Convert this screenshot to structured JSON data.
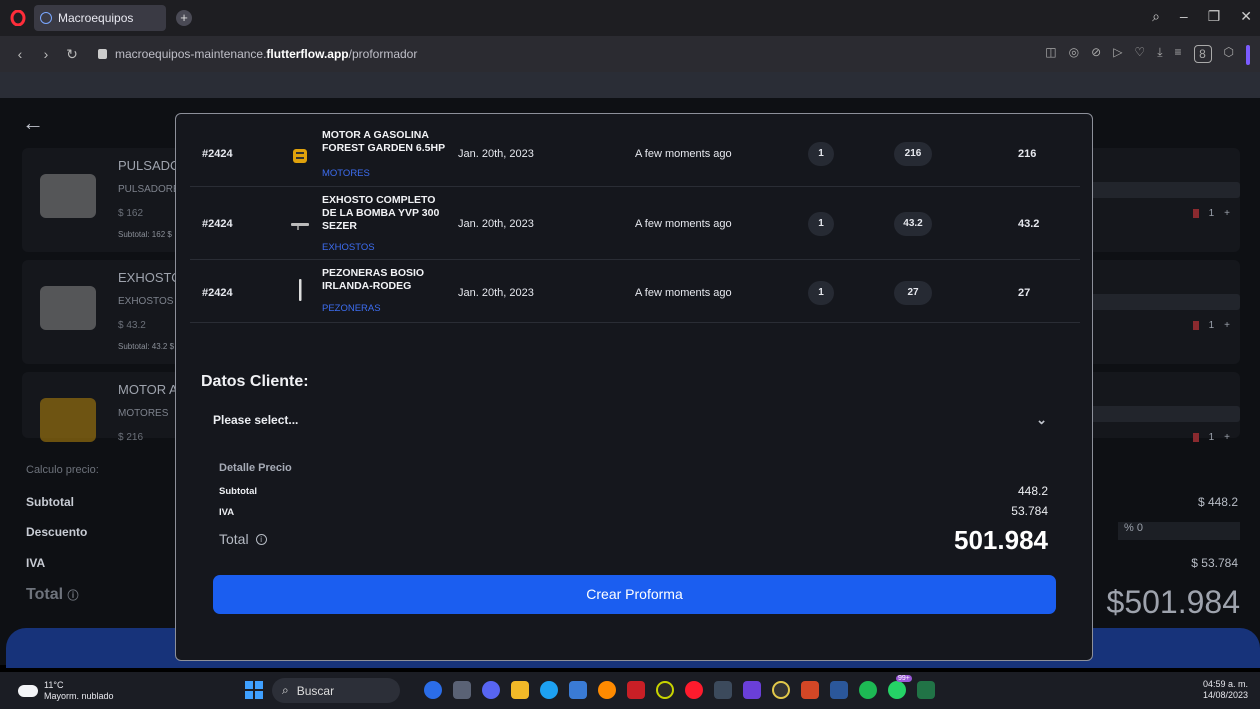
{
  "browser": {
    "tab_title": "Macroequipos",
    "url_prefix": "macroequipos-maintenance.",
    "url_domain": "flutterflow.app",
    "url_path": "/proformador",
    "account_badge": "8"
  },
  "background_page": {
    "items": [
      {
        "name": "PULSADOR",
        "category": "PULSADORES",
        "price": "$ 162",
        "subtotal": "Subtotal: 162 $",
        "qty": "1"
      },
      {
        "name": "EXHOSTO",
        "category": "EXHOSTOS",
        "price": "$ 43.2",
        "subtotal": "Subtotal: 43.2 $",
        "qty": "1"
      },
      {
        "name": "MOTOR A",
        "category": "MOTORES",
        "price": "$ 216",
        "subtotal": "",
        "qty": "1"
      }
    ],
    "calc_label": "Calculo precio:",
    "subtotal_label": "Subtotal",
    "subtotal_value": "$ 448.2",
    "descuento_label": "Descuento",
    "descuento_value": "% 0",
    "iva_label": "IVA",
    "iva_value": "$ 53.784",
    "total_label": "Total",
    "total_value": "$501.984"
  },
  "modal": {
    "rows": [
      {
        "id": "#2424",
        "name": "MOTOR A GASOLINA FOREST GARDEN 6.5HP",
        "category": "MOTORES",
        "date": "Jan. 20th, 2023",
        "ago": "A few moments ago",
        "qty": "1",
        "unit": "216",
        "total": "216"
      },
      {
        "id": "#2424",
        "name": "EXHOSTO COMPLETO DE LA BOMBA YVP 300 SEZER",
        "category": "EXHOSTOS",
        "date": "Jan. 20th, 2023",
        "ago": "A few moments ago",
        "qty": "1",
        "unit": "43.2",
        "total": "43.2"
      },
      {
        "id": "#2424",
        "name": "PEZONERAS BOSIO IRLANDA-RODEG",
        "category": "PEZONERAS",
        "date": "Jan. 20th, 2023",
        "ago": "A few moments ago",
        "qty": "1",
        "unit": "27",
        "total": "27"
      }
    ],
    "datos_title": "Datos Cliente:",
    "select_placeholder": "Please select...",
    "detalle_title": "Detalle Precio",
    "subtotal_label": "Subtotal",
    "subtotal_value": "448.2",
    "iva_label": "IVA",
    "iva_value": "53.784",
    "total_label": "Total",
    "total_value": "501.984",
    "crear_label": "Crear Proforma"
  },
  "taskbar": {
    "temp": "11°C",
    "weather": "Mayorm. nublado",
    "search": "Buscar",
    "badge": "99+",
    "time": "04:59 a. m.",
    "date": "14/08/2023"
  }
}
